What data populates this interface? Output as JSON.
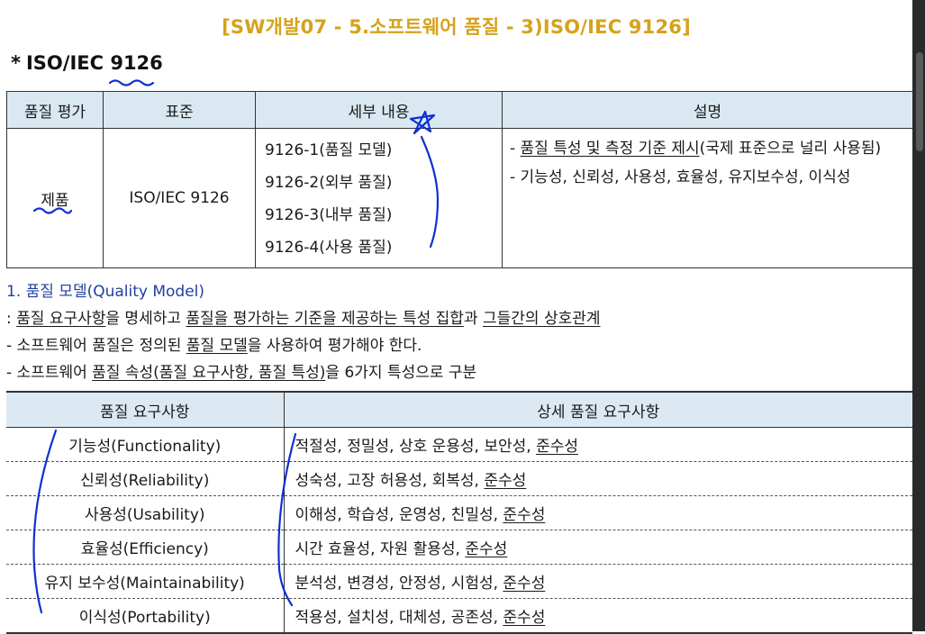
{
  "slide_title": "[SW개발07 - 5.소프트웨어 품질 - 3)ISO/IEC 9126]",
  "heading": {
    "star": "*",
    "text": "ISO/IEC 9126"
  },
  "table1": {
    "headers": [
      "품질 평가",
      "표준",
      "세부 내용",
      "설명"
    ],
    "row": {
      "evaluation": "제품",
      "standard": "ISO/IEC 9126",
      "details": [
        "9126-1(품질 모델)",
        "9126-2(외부 품질)",
        "9126-3(내부 품질)",
        "9126-4(사용 품질)"
      ],
      "desc1_underlined": "품질 특성 및 측정 기준 제시",
      "desc1_dash": "- ",
      "desc1_rest": "(국제 표준으로 널리 사용됨)",
      "desc2": "- 기능성, 신뢰성, 사용성, 효율성, 유지보수성, 이식성"
    }
  },
  "section1": {
    "title": "1. 품질 모델(Quality Model)",
    "line1": {
      "prefix": ": ",
      "u1": "품질 요구사항",
      "t1": "을 명세하고 ",
      "u2": "품질을 평가하는 기준을 제공하는 특성 집합",
      "t2": "과 ",
      "u3": "그들간의 상호관계"
    },
    "line2": {
      "prefix": "- 소프트웨어 품질은 정의된 ",
      "u1": "품질 모델",
      "t1": "을 사용하여 평가해야 한다."
    },
    "line3": {
      "prefix": "- 소프트웨어 ",
      "u1": "품질 속성(품질 요구사항, 품질 특성)",
      "t1": "을 6가지 특성으로 구분"
    }
  },
  "table2": {
    "headers": [
      "품질 요구사항",
      "상세 품질 요구사항"
    ],
    "rows": [
      {
        "req": "기능성(Functionality)",
        "detail": "적절성, 정밀성, 상호 운용성, 보안성, ",
        "u": "준수성"
      },
      {
        "req": "신뢰성(Reliability)",
        "detail": "성숙성, 고장 허용성, 회복성, ",
        "u": "준수성"
      },
      {
        "req": "사용성(Usability)",
        "detail": "이해성, 학습성, 운영성, 친밀성, ",
        "u": "준수성"
      },
      {
        "req": "효율성(Efficiency)",
        "detail": "시간 효율성, 자원 활용성, ",
        "u": "준수성"
      },
      {
        "req": "유지 보수성(Maintainability)",
        "detail": "분석성, 변경성, 안정성, 시험성, ",
        "u": "준수성"
      },
      {
        "req": "이식성(Portability)",
        "detail": "적용성, 설치성, 대체성, 공존성, ",
        "u": "준수성"
      }
    ]
  },
  "colors": {
    "title": "#d6a21a",
    "section": "#1f3fa0",
    "header_bg": "#d9e8f1",
    "ink": "#1030d0"
  }
}
